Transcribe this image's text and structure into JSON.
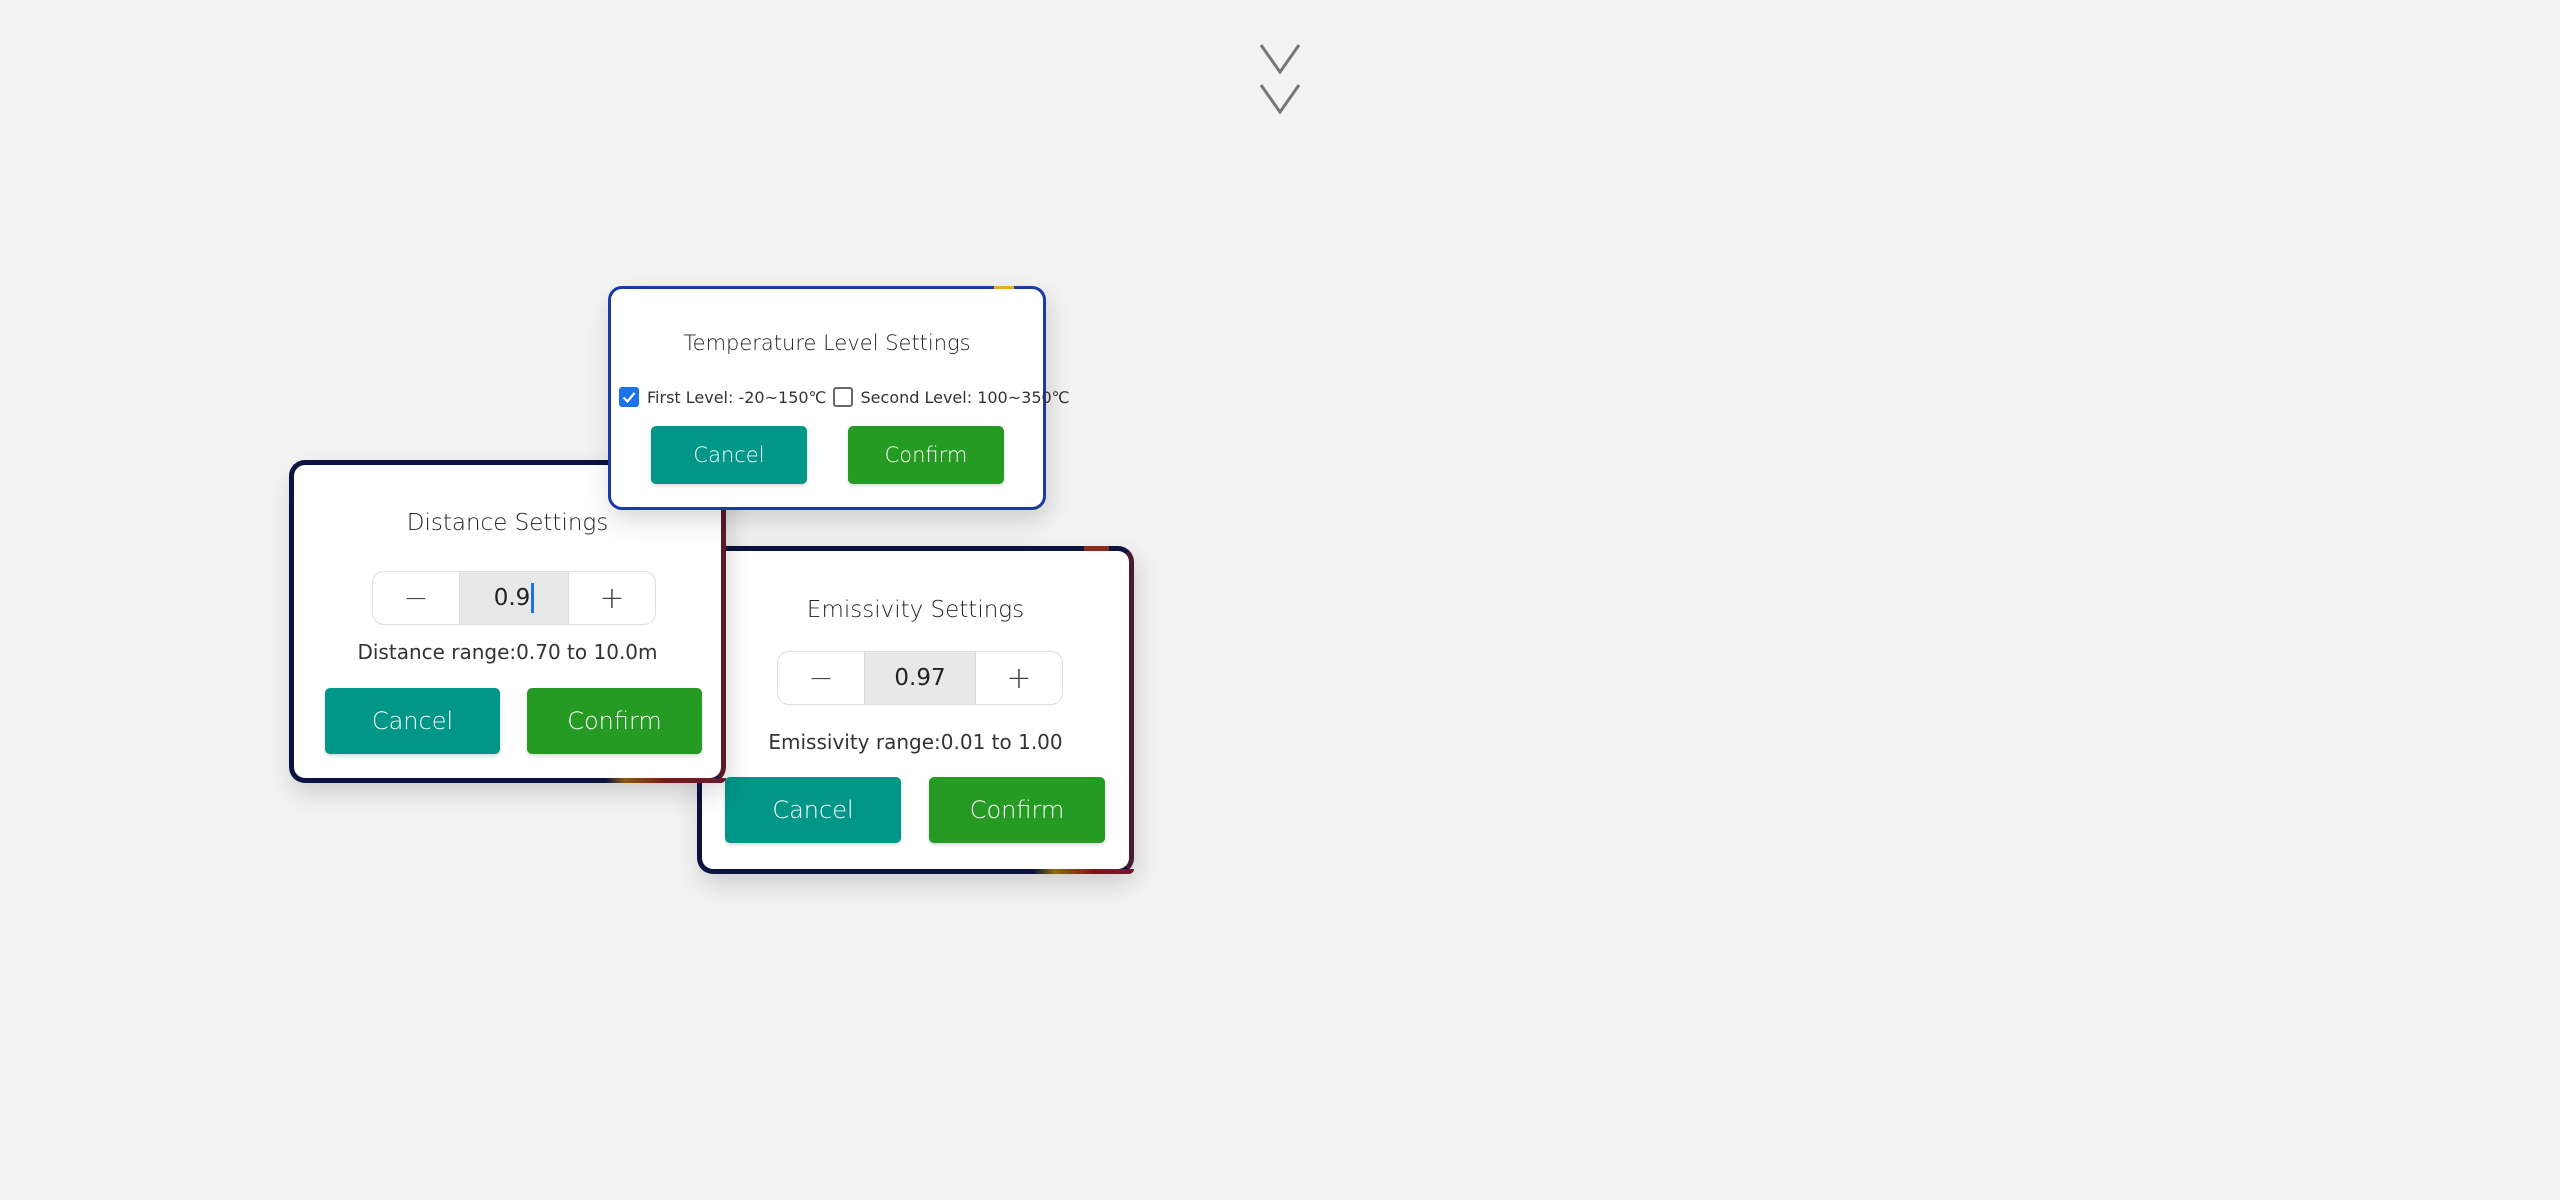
{
  "page": {
    "scroll_hint_icon": "double-chevron-down-icon"
  },
  "temperature_dialog": {
    "title": "Temperature Level Settings",
    "options": [
      {
        "label": "First Level: -20~150℃",
        "checked": true
      },
      {
        "label": "Second Level: 100~350℃",
        "checked": false
      }
    ],
    "cancel_label": "Cancel",
    "confirm_label": "Confirm",
    "border_color": "#1a3aa8"
  },
  "distance_dialog": {
    "title": "Distance Settings",
    "value": "0.9",
    "decrement_icon": "minus-icon",
    "increment_icon": "plus-icon",
    "range_text": "Distance range:0.70 to 10.0m",
    "cancel_label": "Cancel",
    "confirm_label": "Confirm"
  },
  "emissivity_dialog": {
    "title": "Emissivity Settings",
    "value": "0.97",
    "decrement_icon": "minus-icon",
    "increment_icon": "plus-icon",
    "range_text": "Emissivity range:0.01 to 1.00",
    "cancel_label": "Cancel",
    "confirm_label": "Confirm"
  },
  "colors": {
    "background": "#f3f3f3",
    "cancel_button": "#009688",
    "confirm_button": "#259b24",
    "checkbox_checked": "#1a73e8",
    "dialog_border": "#0b1440"
  },
  "glyphs": {
    "minus": "−",
    "plus": "+"
  }
}
